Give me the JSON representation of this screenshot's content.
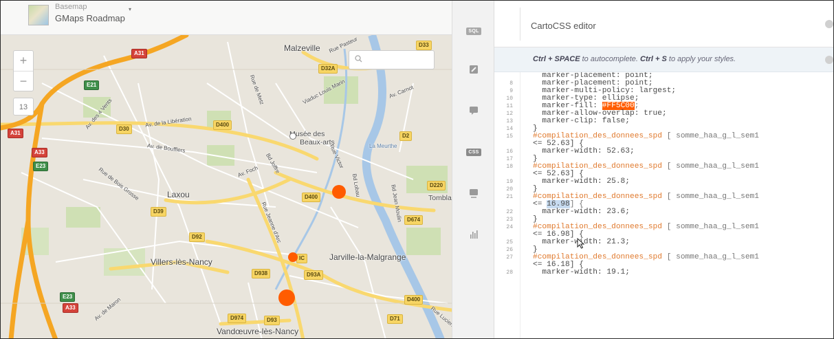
{
  "basemap": {
    "caption": "Basemap",
    "name": "GMaps Roadmap",
    "caret": "▾"
  },
  "map": {
    "zoom_in": "+",
    "zoom_out": "−",
    "zoom_level": "13",
    "search_placeholder": "",
    "search_icon": "search-icon",
    "places": [
      "Malzeville",
      "Musée des",
      "Beaux-arts",
      "Laxou",
      "Villers-lès-Nancy",
      "Jarville-la-Malgrange",
      "Vandœuvre-lès-Nancy",
      "La Meurthe",
      "Tomblaine"
    ],
    "streets": [
      "Rue Pasteur",
      "Viaduc Louis Marin",
      "Av. Carnot",
      "Rue de Metz",
      "Av. de la Libération",
      "Av. de Boufflers",
      "Av. Foch",
      "Bd Joffre",
      "Rue Victor",
      "Bd Lobau",
      "Bd Jean Moulin",
      "Rue Jeanne d'Arc",
      "Av. des 4 Vents",
      "Rue de Bois Grosse",
      "Av. de Maron",
      "Rue Lucien"
    ],
    "road_badges": [
      {
        "text": "A31",
        "kind": "red"
      },
      {
        "text": "E21",
        "kind": "green"
      },
      {
        "text": "D33",
        "kind": "yellow"
      },
      {
        "text": "D32A",
        "kind": "yellow"
      },
      {
        "text": "D30",
        "kind": "yellow"
      },
      {
        "text": "D400",
        "kind": "yellow"
      },
      {
        "text": "A31",
        "kind": "red"
      },
      {
        "text": "A33",
        "kind": "red"
      },
      {
        "text": "E23",
        "kind": "green"
      },
      {
        "text": "D2",
        "kind": "yellow"
      },
      {
        "text": "D39",
        "kind": "yellow"
      },
      {
        "text": "D400",
        "kind": "yellow"
      },
      {
        "text": "D220",
        "kind": "yellow"
      },
      {
        "text": "D674",
        "kind": "yellow"
      },
      {
        "text": "D92",
        "kind": "yellow"
      },
      {
        "text": "D938",
        "kind": "yellow"
      },
      {
        "text": "D93A",
        "kind": "yellow"
      },
      {
        "text": "E23",
        "kind": "green"
      },
      {
        "text": "A33",
        "kind": "red"
      },
      {
        "text": "D400",
        "kind": "yellow"
      },
      {
        "text": "D974",
        "kind": "yellow"
      },
      {
        "text": "D93",
        "kind": "yellow"
      },
      {
        "text": "D71",
        "kind": "yellow"
      },
      {
        "text": "IC",
        "kind": "yellow"
      }
    ],
    "marker_color": "#FF5C00"
  },
  "toolbar": {
    "items": [
      {
        "id": "sql",
        "label": "SQL",
        "icon": "sql-icon"
      },
      {
        "id": "wizard",
        "label": "",
        "icon": "paintbrush-icon"
      },
      {
        "id": "infowindow",
        "label": "",
        "icon": "speech-bubble-icon"
      },
      {
        "id": "css",
        "label": "CSS",
        "icon": "css-icon"
      },
      {
        "id": "legend",
        "label": "",
        "icon": "legend-icon"
      },
      {
        "id": "charts",
        "label": "",
        "icon": "bar-chart-icon"
      }
    ]
  },
  "editor": {
    "title": "CartoCSS editor",
    "hint_key1": "Ctrl + SPACE",
    "hint_mid": " to autocomplete. ",
    "hint_key2": "Ctrl + S",
    "hint_end": " to apply your styles.",
    "lines": [
      {
        "n": "",
        "t": "  marker-placement: point;"
      },
      {
        "n": "8",
        "t": "  marker-placement: point;"
      },
      {
        "n": "9",
        "t": "  marker-multi-policy: largest;"
      },
      {
        "n": "10",
        "t": "  marker-type: ellipse;"
      },
      {
        "n": "11",
        "pre": "  marker-fill: ",
        "hl": "#FF5C00",
        "post": ";"
      },
      {
        "n": "12",
        "t": "  marker-allow-overlap: true;"
      },
      {
        "n": "13",
        "t": "  marker-clip: false;"
      },
      {
        "n": "14",
        "t": "}"
      },
      {
        "n": "15",
        "sel": "#compilation_des_donnees_spd",
        "post": " [ somme_haa_g_l_sem1"
      },
      {
        "n": "",
        "t": "<= 52.63] {"
      },
      {
        "n": "16",
        "t": "  marker-width: 52.63;"
      },
      {
        "n": "17",
        "t": "}"
      },
      {
        "n": "18",
        "sel": "#compilation_des_donnees_spd",
        "post": " [ somme_haa_g_l_sem1"
      },
      {
        "n": "",
        "t": "<= 52.63] {"
      },
      {
        "n": "19",
        "t": "  marker-width: 25.8;"
      },
      {
        "n": "20",
        "t": "}"
      },
      {
        "n": "21",
        "sel": "#compilation_des_donnees_spd",
        "post": " [ somme_haa_g_l_sem1"
      },
      {
        "n": "",
        "pre": "<= ",
        "hlb": "16.98",
        "post": "] {"
      },
      {
        "n": "22",
        "t": "  marker-width: 23.6;"
      },
      {
        "n": "23",
        "t": "}"
      },
      {
        "n": "24",
        "sel": "#compilation_des_donnees_spd",
        "post": " [ somme_haa_g_l_sem1"
      },
      {
        "n": "",
        "t": "<= 16.98] {"
      },
      {
        "n": "25",
        "t": "  marker-width: 21.3;"
      },
      {
        "n": "26",
        "t": "}"
      },
      {
        "n": "27",
        "sel": "#compilation_des_donnees_spd",
        "post": " [ somme_haa_g_l_sem1"
      },
      {
        "n": "",
        "t": "<= 16.18] {"
      },
      {
        "n": "28",
        "t": "  marker-width: 19.1;"
      }
    ]
  }
}
